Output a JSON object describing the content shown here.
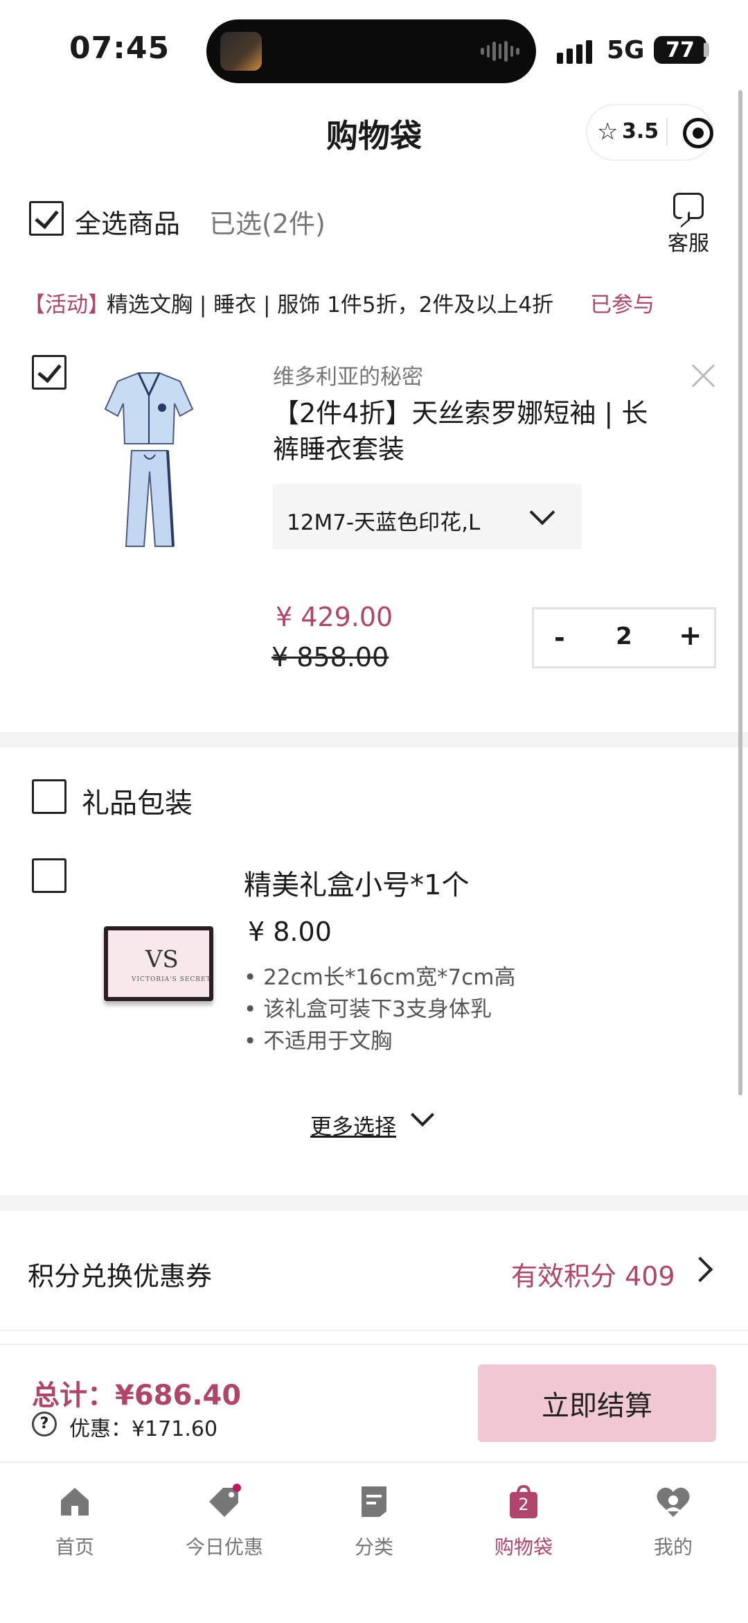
{
  "status_bar": {
    "time": "07:45",
    "network": "5G",
    "battery": "77"
  },
  "header": {
    "title": "购物袋",
    "rating": "3.5"
  },
  "selection": {
    "select_all_label": "全选商品",
    "selected_count": "已选(2件)",
    "service_label": "客服"
  },
  "promo": {
    "tag": "【活动】",
    "text": "精选文胸 | 睡衣 | 服饰 1件5折，2件及以上4折",
    "status": "已参与"
  },
  "product": {
    "checked": true,
    "brand": "维多利亚的秘密",
    "title": "【2件4折】天丝索罗娜短袖 | 长裤睡衣套装",
    "variant": "12M7-天蓝色印花,L",
    "price": "¥ 429.00",
    "original_price": "¥ 858.00",
    "quantity": "2",
    "minus": "-",
    "plus": "+"
  },
  "gift": {
    "section_title": "礼品包装",
    "item_name": "精美礼盒小号*1个",
    "item_price": "¥ 8.00",
    "bullets": [
      "22cm长*16cm宽*7cm高",
      "该礼盒可装下3支身体乳",
      "不适用于文胸"
    ],
    "box_logo": "VS",
    "box_brand": "VICTORIA'S SECRET",
    "more_label": "更多选择"
  },
  "points": {
    "label": "积分兑换优惠券",
    "value": "有效积分 409"
  },
  "checkout": {
    "total": "总计：¥686.40",
    "discount": "优惠：¥171.60",
    "button": "立即结算"
  },
  "tabs": [
    {
      "label": "首页",
      "icon": "home-icon"
    },
    {
      "label": "今日优惠",
      "icon": "tag-icon"
    },
    {
      "label": "分类",
      "icon": "category-icon"
    },
    {
      "label": "购物袋",
      "icon": "bag-icon",
      "badge": "2",
      "active": true
    },
    {
      "label": "我的",
      "icon": "profile-icon"
    }
  ],
  "colors": {
    "accent": "#b0446a",
    "checkout_button": "#f0c9d2",
    "tab_inactive": "#777777"
  }
}
